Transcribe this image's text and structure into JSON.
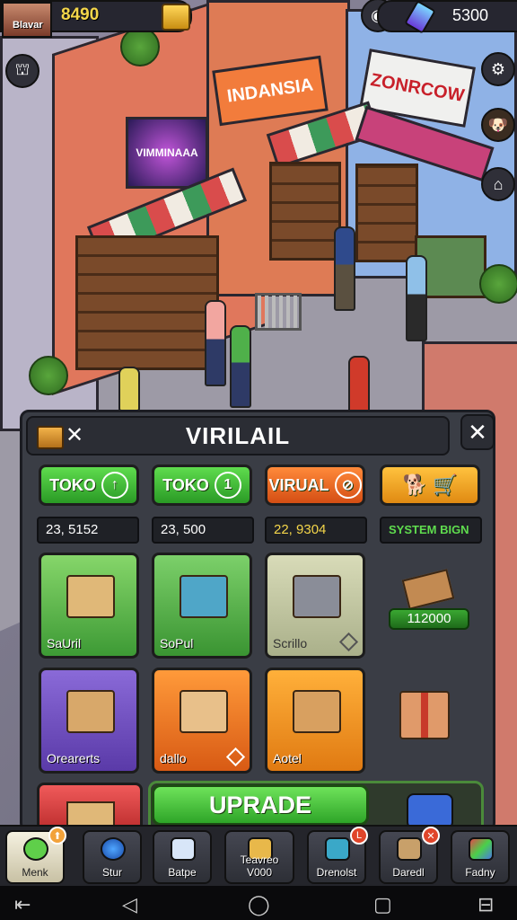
{
  "hud": {
    "player_name": "Blavar",
    "coins": "8490",
    "gems": "5300"
  },
  "storefronts": {
    "sign_1": "VIMMINAAA",
    "sign_2": "INDANSIA",
    "sign_3": "ZONRCOW"
  },
  "panel": {
    "title": "VIRILAIL",
    "tabs": [
      {
        "label": "TOKO",
        "icon": "↑"
      },
      {
        "label": "TOKO",
        "icon": "1"
      },
      {
        "label": "VIRUAL",
        "icon": "⊘"
      }
    ],
    "values": [
      "23, 5152",
      "23, 500",
      "22, 9304",
      "SYSTEM BIGN"
    ],
    "cards": [
      {
        "label": "SaUril"
      },
      {
        "label": "SoPul"
      },
      {
        "label": "Scrillo"
      },
      {
        "label": "Orearerts"
      },
      {
        "label": "dallo"
      },
      {
        "label": "Aotel"
      }
    ],
    "price": "112000",
    "upgrade_label": "UPRADE"
  },
  "nav": [
    {
      "label": "Menk",
      "badge": "⬆"
    },
    {
      "label": "Stur",
      "badge": ""
    },
    {
      "label": "Batpe",
      "badge": ""
    },
    {
      "label": "Teavreo V000",
      "badge": ""
    },
    {
      "label": "Drenolst",
      "badge": "L"
    },
    {
      "label": "Daredl",
      "badge": ""
    },
    {
      "label": "Fadny",
      "badge": ""
    }
  ],
  "colors": {
    "accent_green": "#2a9a25",
    "accent_orange": "#d44e14",
    "gold": "#f4d64a"
  }
}
